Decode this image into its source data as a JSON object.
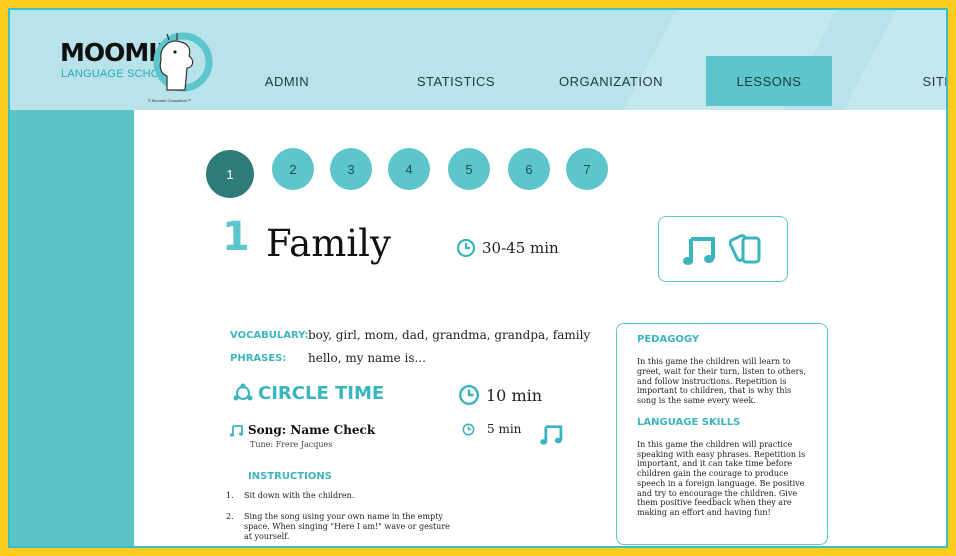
{
  "app": {
    "logo_title": "MOOMIN",
    "logo_subtitle": "LANGUAGE SCHOOL",
    "logo_copyright": "© Moomin Characters™"
  },
  "nav": {
    "items": [
      {
        "label": "ADMIN",
        "active": false
      },
      {
        "label": "STATISTICS",
        "active": false
      },
      {
        "label": "ORGANIZATION",
        "active": false
      },
      {
        "label": "LESSONS",
        "active": true
      },
      {
        "label": "SITE",
        "active": false
      }
    ]
  },
  "lessons": {
    "numbers": [
      "1",
      "2",
      "3",
      "4",
      "5",
      "6",
      "7"
    ],
    "active": "1"
  },
  "lesson": {
    "number": "1",
    "title": "Family",
    "duration": "30-45 min",
    "media_icons": [
      "music-note-icon",
      "cards-icon"
    ]
  },
  "vocabulary": {
    "vocab_label": "VOCABULARY:",
    "vocab_value": "boy, girl, mom, dad, grandma, grandpa, family",
    "phrases_label": "PHRASES:",
    "phrases_value": "hello, my name is..."
  },
  "circle_time": {
    "title": "CIRCLE TIME",
    "duration": "10 min",
    "song": {
      "title": "Song: Name Check",
      "tune": "Tune: Frere Jacques",
      "duration": "5 min"
    },
    "instructions_heading": "INSTRUCTIONS",
    "instructions": [
      {
        "num": "1.",
        "text": "Sit down with the children."
      },
      {
        "num": "2.",
        "text": "Sing the song using your own name in the empty space. When singing \"Here I am!\" wave or gesture at yourself."
      }
    ]
  },
  "pedagogy": {
    "heading": "PEDAGOGY",
    "text": "In this game the children will learn to greet, wait for their turn, listen to others, and follow instructions. Repetition is important to children, that is why this song is the same every week.",
    "language_heading": "LANGUAGE SKILLS",
    "language_text": "In this game the children will practice speaking with easy phrases. Repetition is important, and it can take time before children gain the courage to produce speech in a foreign language. Be positive and try to encourage the children. Give them positive feedback when they are making an effort and having fun!"
  },
  "colors": {
    "frame": "#f9cc1f",
    "accent": "#5cc6cc",
    "accent_dark": "#2f7b7a",
    "header_bg": "#b8e3ea",
    "heading_teal": "#3bb5bd"
  }
}
